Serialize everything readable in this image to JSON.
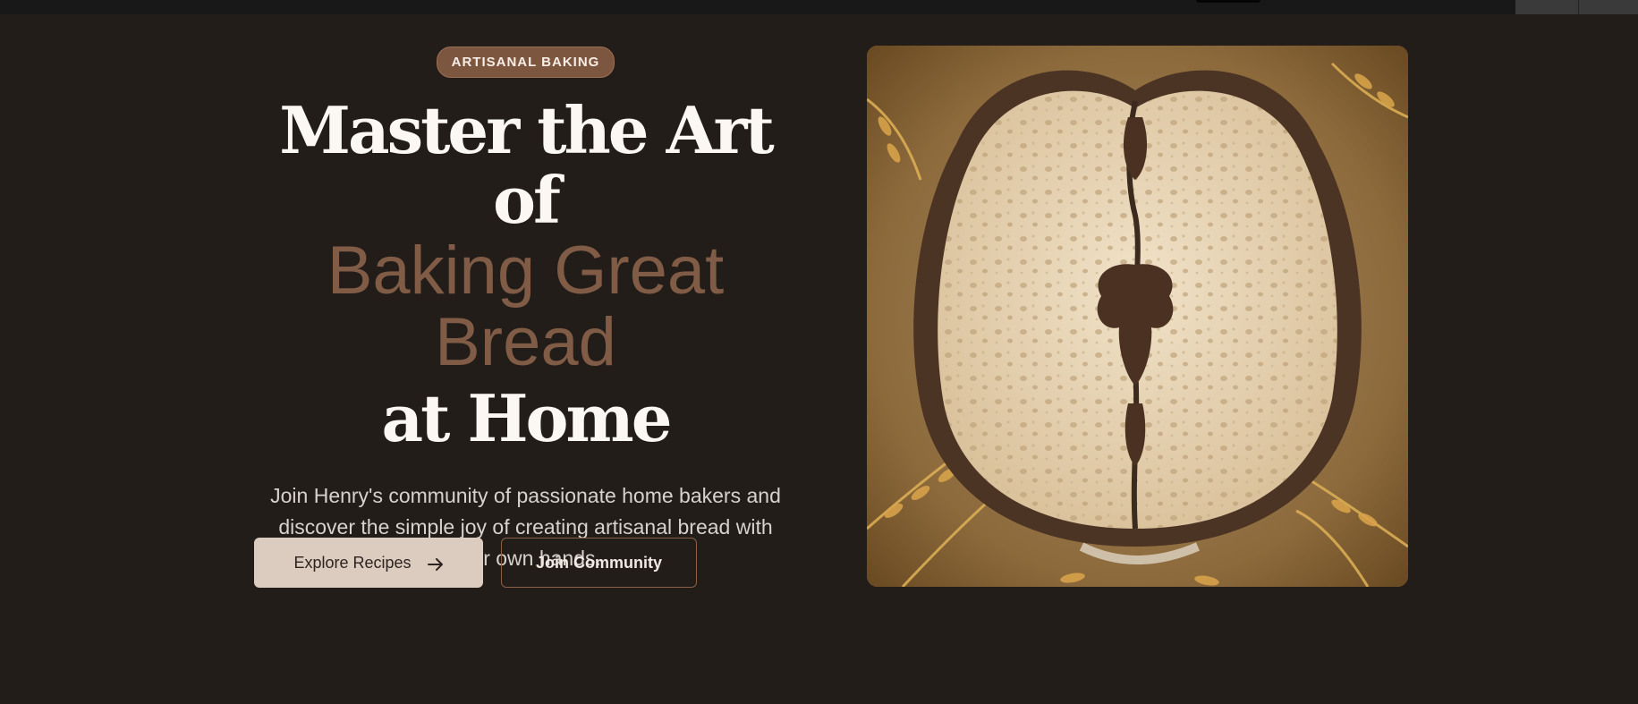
{
  "hero": {
    "badge": "ARTISANAL BAKING",
    "headline_line1": "Master the Art of",
    "headline_accent_line1": "Baking Great",
    "headline_accent_line2": "Bread",
    "headline_line2": "at Home",
    "subcopy": "Join Henry's community of passionate home bakers and discover the simple joy of creating artisanal bread with your own hands.",
    "primary_button": "Explore Recipes",
    "secondary_button": "Join Community",
    "image_icon": "bread-loaf-photo"
  },
  "colors": {
    "background": "#221d19",
    "accent": "#805b45",
    "badge_bg": "#7d5640",
    "primary_button_bg": "#dccbbf"
  }
}
